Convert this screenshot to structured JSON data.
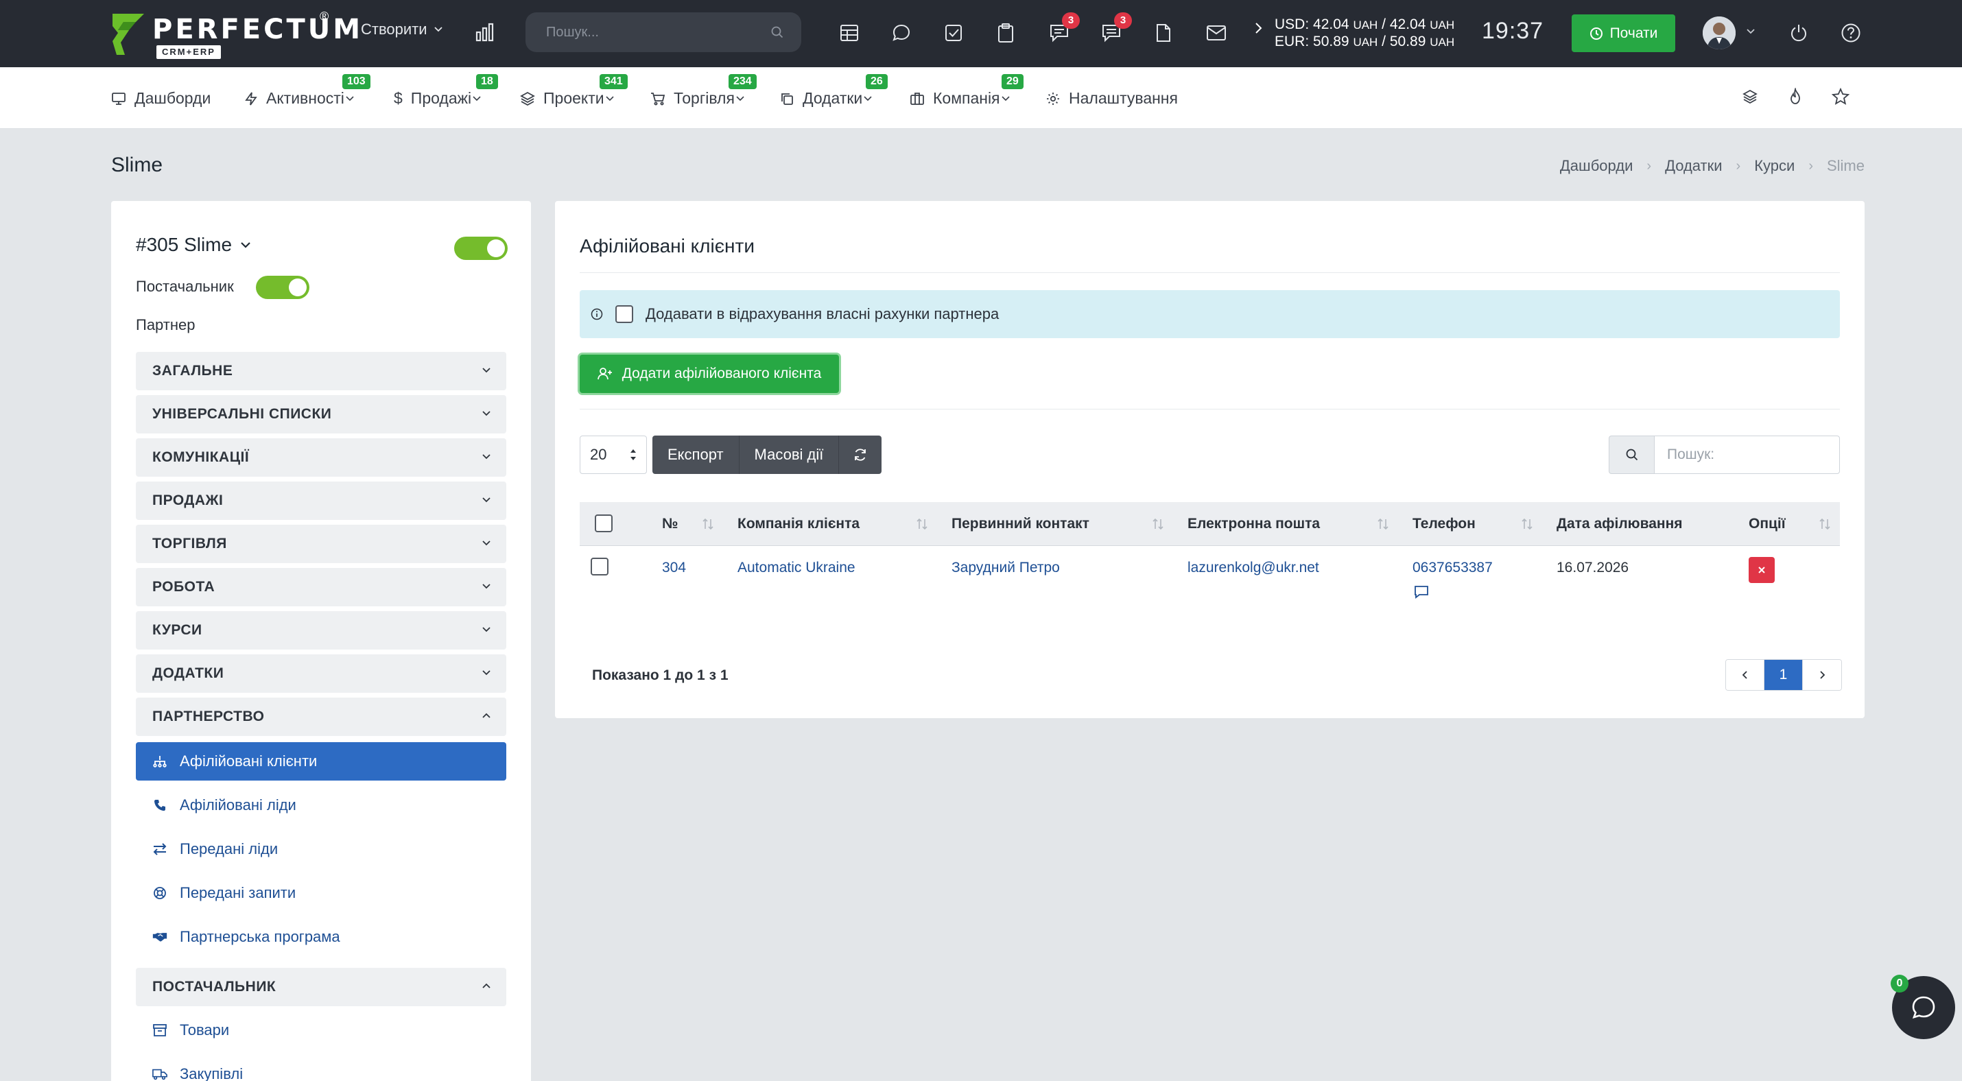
{
  "app": {
    "brand": "PERFECTUM",
    "brand_sub": "CRM+ERP",
    "brand_reg": "®"
  },
  "topbar": {
    "create_label": "Створити",
    "search_placeholder": "Пошук...",
    "chat_badge_1": "3",
    "chat_badge_2": "3",
    "rates_usd_label": "USD:",
    "rates_usd_1": "42.04",
    "rates_usd_2": "42.04",
    "rates_eur_label": "EUR:",
    "rates_eur_1": "50.89",
    "rates_eur_2": "50.89",
    "currency": "UAH",
    "clock": "19:37",
    "start_label": "Почати"
  },
  "nav": {
    "dashboards": "Дашборди",
    "activities": "Активності",
    "activities_count": "103",
    "sales": "Продажі",
    "sales_count": "18",
    "projects": "Проекти",
    "projects_count": "341",
    "trade": "Торгівля",
    "trade_count": "234",
    "addons": "Додатки",
    "addons_count": "26",
    "company": "Компанія",
    "company_count": "29",
    "settings": "Налаштування"
  },
  "page": {
    "title": "Slime",
    "breadcrumb": [
      "Дашборди",
      "Додатки",
      "Курси",
      "Slime"
    ]
  },
  "sidebar": {
    "title": "#305 Slime",
    "supplier_label": "Постачальник",
    "partner_label": "Партнер",
    "sections": [
      "ЗАГАЛЬНЕ",
      "УНІВЕРСАЛЬНІ СПИСКИ",
      "КОМУНІКАЦІЇ",
      "ПРОДАЖІ",
      "ТОРГІВЛЯ",
      "РОБОТА",
      "КУРСИ",
      "ДОДАТКИ",
      "ПАРТНЕРСТВО"
    ],
    "partnership_items": [
      "Афілійовані клієнти",
      "Афілійовані ліди",
      "Передані ліди",
      "Передані запити",
      "Партнерська програма"
    ],
    "supplier_section": "ПОСТАЧАЛЬНИК",
    "supplier_items": [
      "Товари",
      "Закупівлі"
    ]
  },
  "main": {
    "title": "Афілійовані клієнти",
    "alert_text": "Додавати в відрахування власні рахунки партнера",
    "add_button": "Додати афілійованого клієнта",
    "page_length": "20",
    "export_label": "Експорт",
    "bulk_label": "Масові дії",
    "search_placeholder": "Пошук:",
    "columns": [
      "№",
      "Компанія клієнта",
      "Первинний контакт",
      "Електронна пошта",
      "Телефон",
      "Дата афілювання",
      "Опції"
    ],
    "rows": [
      {
        "id": "304",
        "company": "Automatic Ukraine",
        "contact": "Зарудний Петро",
        "email": "lazurenkolg@ukr.net",
        "phone": "0637653387",
        "date": "16.07.2026"
      }
    ],
    "info": "Показано 1 до 1 з 1",
    "current_page": "1"
  },
  "chat": {
    "count": "0"
  },
  "colors": {
    "topbar": "#272b33",
    "accent_green": "#27a844",
    "accent_blue": "#2d6bc3",
    "danger": "#e03546",
    "toggle_green": "#75bc2c"
  }
}
